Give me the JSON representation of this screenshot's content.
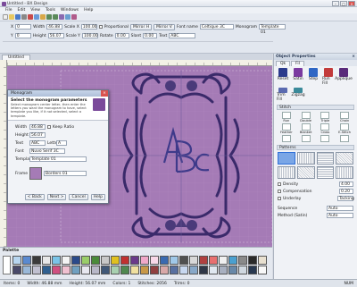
{
  "window": {
    "title": "Untitled - BX Design"
  },
  "menu": [
    "File",
    "Edit",
    "View",
    "Tools",
    "Windows",
    "Help"
  ],
  "propbar": {
    "row1": [
      {
        "label": "X",
        "value": "0"
      },
      {
        "label": "Width",
        "value": "46.88"
      },
      {
        "label": "Scale X",
        "value": "100.00"
      }
    ],
    "row2": [
      {
        "label": "Y",
        "value": "0"
      },
      {
        "label": "Height",
        "value": "56.07"
      },
      {
        "label": "Scale Y",
        "value": "100.00"
      }
    ],
    "proportional_label": "Proportional",
    "mirror_h": "Mirror H",
    "mirror_v": "Mirror V",
    "rotate_label": "Rotate",
    "rotate_value": "0.00",
    "slant_label": "Slant",
    "slant_value": "0.00",
    "font_label": "Font name",
    "font_value": "Celtique 3C",
    "monogram_label": "Monogram",
    "monogram_value": "Template 01",
    "text_label": "Text",
    "text_value": "ABC"
  },
  "doctab": "Untitled",
  "side": {
    "title": "Object Properties",
    "tabs": [
      "Qk",
      "Fil"
    ],
    "tools": [
      {
        "label": "Reset",
        "color": "#2b3a8c"
      },
      {
        "label": "Satin",
        "color": "#7a3aa0"
      },
      {
        "label": "Step",
        "color": "#2f66c4"
      },
      {
        "label": "Run Fill",
        "color": "#c23a3a"
      },
      {
        "label": "Applique",
        "color": "#5a2a7a"
      }
    ],
    "tools2": [
      "Trim Fill",
      "Zigzag"
    ],
    "stitch_section": "Stitch",
    "stitches": [
      "Run",
      "Double",
      "Triple",
      "Chain",
      "Feather",
      "Blanket",
      "Cross",
      "E-Stitch",
      "",
      "",
      "",
      "",
      "",
      "",
      "",
      ""
    ],
    "patterns_section": "Patterns",
    "pattern_count": 12,
    "options": [
      "Density",
      "Compensation",
      "Underlay"
    ],
    "option_values": [
      "4.00",
      "0.20",
      "Tacking"
    ],
    "sequence_label": "Sequence",
    "sequence_value": "Auto",
    "method_label": "Method (Satin)",
    "method_value": "Auto"
  },
  "dialog": {
    "title": "Monogram",
    "heading": "Select the monogram parameters",
    "desc": "Select monogram center letter, then enter the letters you want the monogram to have, select template you like, if it not selected, select a template.",
    "fields": [
      {
        "label": "Width",
        "value": "46.88"
      },
      {
        "label": "Height",
        "value": "56.07"
      },
      {
        "label": "Text",
        "value": "ABC"
      },
      {
        "label": "Letter",
        "value": "A"
      }
    ],
    "keep_ratio": "Keep Ratio",
    "font_label": "Font",
    "font_value": "Nuvo Serif 3C",
    "template_label": "Template",
    "template_value": "Template 01",
    "frame_label": "Frame",
    "frame_value": "Borders 01",
    "buttons": [
      "< Back",
      "Next >",
      "Cancel",
      "Help"
    ]
  },
  "palette": {
    "title": "Palette",
    "colors": [
      "#b8d6f0",
      "#5a8ad0",
      "#3a3a3a",
      "#e8e8e8",
      "#7ac4e8",
      "#f4f4f4",
      "#2a4a8a",
      "#9acd6a",
      "#4a8a3a",
      "#c8c8c8",
      "#e0c020",
      "#c03030",
      "#6a3a8a",
      "#f0a8c8",
      "#f8d8e8",
      "#3a6ab0",
      "#a0c8e8",
      "#505050",
      "#d8d8d8",
      "#b04040",
      "#e87070",
      "#f0f0f0",
      "#4aa0d0",
      "#8a8a8a",
      "#2a2a2a",
      "#e8e0d0",
      "#4a4a6a",
      "#9ab8d8",
      "#c0c0d0",
      "#306090",
      "#d05080",
      "#f0c0d0",
      "#70a0c0",
      "#e8e8f0",
      "#b8b8c8",
      "#405878",
      "#a8d0b0",
      "#508850",
      "#f0e0a0",
      "#c89848",
      "#904040",
      "#d8a8a8",
      "#5870a0",
      "#c8d8f0",
      "#88a8c8",
      "#303848",
      "#e0e8f0",
      "#a8b0c0",
      "#6888a8",
      "#d0d8e0",
      "#283850",
      "#f8f8f8"
    ]
  },
  "status": [
    "Items: 0",
    "Width: 46.88 mm",
    "Height: 56.07 mm",
    "Colors: 1",
    "Stitches: 2056",
    "Trims: 0",
    "NUM"
  ]
}
